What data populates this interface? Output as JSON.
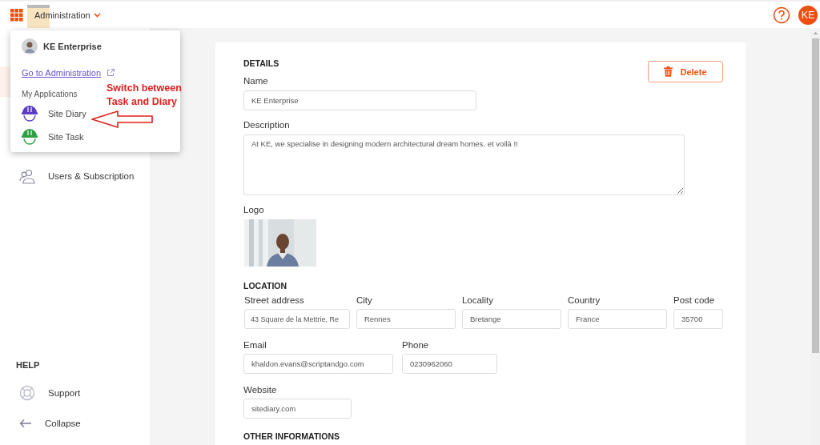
{
  "top_bar": {
    "app_menu": "Administration",
    "avatar": "KE"
  },
  "dropdown": {
    "org_name": "KE Enterprise",
    "admin_link": "Go to Administration",
    "apps_heading": "My Applications",
    "apps": [
      {
        "name": "Site Diary",
        "color": "#5b3cc4"
      },
      {
        "name": "Site Task",
        "color": "#2ea043"
      }
    ]
  },
  "annotation": {
    "lines": [
      "Switch between",
      "Task and Diary"
    ]
  },
  "sidebar": {
    "items": [
      {
        "label": "Users & Subscription"
      }
    ],
    "help_heading": "HELP",
    "help_items": [
      {
        "kind": "support",
        "label": "Support"
      },
      {
        "kind": "collapse",
        "label": "Collapse"
      }
    ]
  },
  "details": {
    "heading": "DETAILS",
    "delete_button": "Delete",
    "name": {
      "label": "Name",
      "value": "KE Enterprise"
    },
    "description": {
      "label": "Description",
      "value": "At KE, we specialise in designing modern architectural dream homes. et voilà !!"
    },
    "logo": {
      "label": "Logo",
      "kind": "picture"
    }
  },
  "location": {
    "heading": "LOCATION",
    "fields": [
      {
        "label": "Street address",
        "value": "43 Square de la Mettrie, Re"
      },
      {
        "label": "City",
        "value": "Rennes"
      },
      {
        "label": "Locality",
        "value": "Bretange"
      },
      {
        "label": "Country",
        "value": "France"
      },
      {
        "label": "Post code",
        "value": "35700"
      }
    ]
  },
  "contact": {
    "fields": [
      {
        "label": "Email",
        "value": "khaldon.evans@scriptandgo.com"
      },
      {
        "label": "Phone",
        "value": "0230962060"
      }
    ],
    "website": {
      "label": "Website",
      "value": "sitediary.com"
    }
  },
  "next_section": {
    "heading": "OTHER INFORMATIONS"
  }
}
